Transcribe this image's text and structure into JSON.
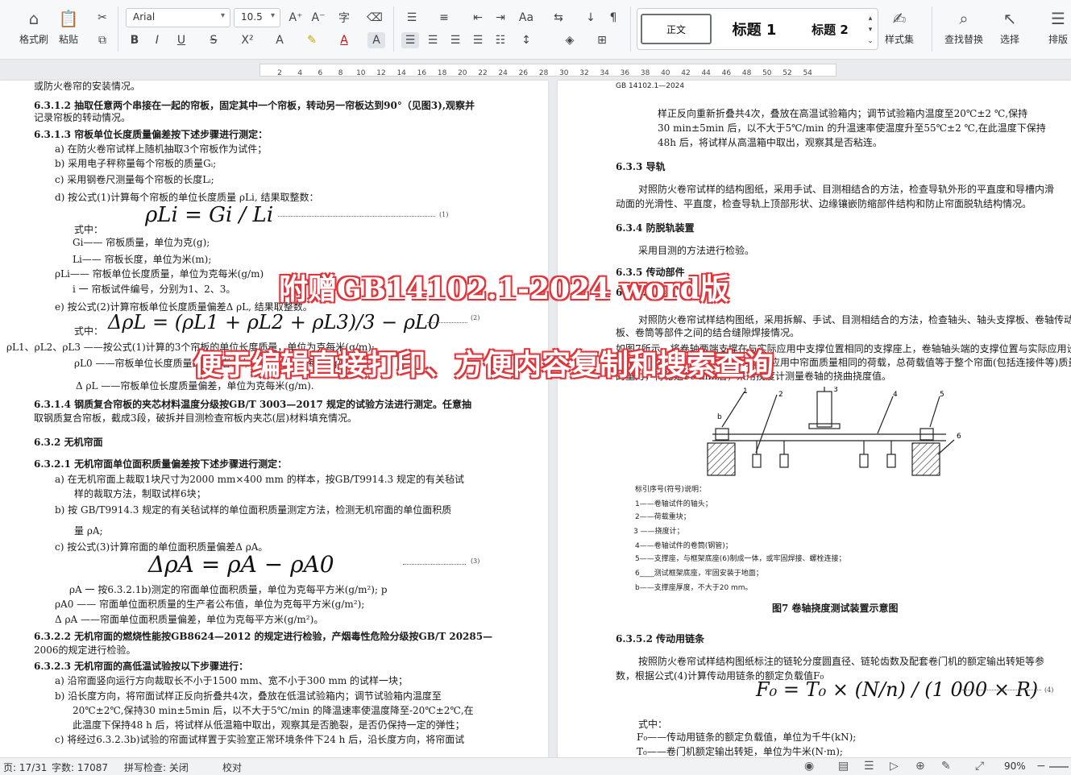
{
  "ribbon": {
    "format_painter": "格式刷",
    "paste": "粘贴",
    "font_name": "Arial",
    "font_size": "10.5",
    "styles": {
      "normal": "正文",
      "h1": "标题 1",
      "h2": "标题 2"
    },
    "style_set": "样式集",
    "find_replace": "查找替换",
    "select": "选择",
    "sort": "排版"
  },
  "ruler": {
    "ticks": [
      "2",
      "4",
      "6",
      "8",
      "10",
      "12",
      "14",
      "16",
      "18",
      "20",
      "22",
      "24",
      "26",
      "28",
      "30",
      "32",
      "34",
      "36",
      "38",
      "40",
      "42",
      "44",
      "46",
      "48",
      "50",
      "52",
      "54"
    ]
  },
  "left_page": {
    "lines": [
      "或防火卷帘的安装情况。",
      "6.3.1.2  抽取任意两个串接在一起的帘板，固定其中一个帘板，转动另一帘板达到90°（见图3),观察并",
      "记录帘板的转动情况。",
      "6.3.1.3  帘板单位长度质量偏差按下述步骤进行测定：",
      "a)   在防火卷帘试样上随机抽取3个帘板作为试件；",
      "b)   采用电子秤称量每个帘板的质量Gᵢ;",
      "c)   采用钢卷尺测量每个帘板的长度Lᵢ;",
      "d)   按公式(1)计算每个帘板的单位长度质量 ρLi, 结果取整数：",
      "式中：",
      "Gi——  帘板质量，单位为克(g);",
      "Li——  帘板长度，单位为米(m);",
      "ρLi——  帘板单位长度质量，单位为克每米(g/m)",
      "i   一 帘板试件编号，分别为1、2、3。",
      "e)   按公式(2)计算帘板单位长度质量偏差Δ ρL, 结果取整数。",
      "式中：",
      "ρL1、ρL2、ρL3 ——按公式(1)计算的3个帘板的单位长度质量，单位为克每米(g/m);",
      "ρL0 ——帘板单位长度质量的生产者公布值，单位为克每米(g/m);",
      "Δ ρL  ——帘板单位长度质量偏差，单位为克每米(g/m).",
      "6.3.1.4  钢质复合帘板的夹芯材料温度分级按GB/T   3003—2017 规定的试验方法进行测定。任意抽",
      "取钢质复合帘板，截成3段，破拆并目测检查帘板内夹芯(层)材料填充情况。",
      "6.3.2  无机帘面",
      "6.3.2.1  无机帘面单位面积质量偏差按下述步骤进行测定：",
      "a)   在无机帘面上裁取1块尺寸为2000 mm×400 mm   的样本，按GB/T9914.3   规定的有关毡试",
      "样的裁取方法，制取试样6块；",
      "b)   按 GB/T9914.3   规定的有关毡试样的单位面积质量测定方法，检测无机帘面的单位面积质",
      "量 ρA;",
      "c)   按公式(3)计算帘面的单位面积质量偏差Δ ρA。",
      "ρA  一  按6.3.2.1b)测定的帘面单位面积质量，单位为克每平方米(g/m²); p",
      "ρA0 ——  帘面单位面积质量的生产者公布值，单位为克每平方米(g/m²);",
      "Δ ρA ——帘面单位面积质量偏差，单位为克每平方米(g/m²)。",
      "6.3.2.2  无机帘面的燃烧性能按GB8624—2012   的规定进行检验，产烟毒性危险分级按GB/T   20285—",
      "2006的规定进行检验。",
      "6.3.2.3  无机帘面的高低温试验按以下步骤进行：",
      "a)   沿帘面竖向运行方向裁取长不小于1500 mm、宽不小于300 mm 的试样一块；",
      "b)   沿长度方向，将帘面试样正反向折叠共4次，叠放在低温试验箱内；调节试验箱内温度至",
      "20℃±2℃,保持30  min±5min  后，以不大于5℃/min 的降温速率使温度降至-20℃±2℃,在",
      "此温度下保持48 h 后，将试样从低温箱中取出，观察其是否脆裂，是否仍保持一定的弹性；",
      "c)   将经过6.3.2.3b)试验的帘面试样置于实验室正常环境条件下24 h 后，沿长度方向，将帘面试"
    ],
    "formulas": {
      "f1": "ρLi = Gi / Li",
      "f2": "ΔρL = (ρL1 + ρL2 + ρL3)/3 − ρL0",
      "f3": "ΔρA = ρA − ρA0",
      "n1": "(1)",
      "n2": "(2)",
      "n3": "(3)"
    }
  },
  "right_page": {
    "header": "GB      14102.1—2024",
    "lines": [
      "样正反向重新折叠共4次，叠放在高温试验箱内；调节试验箱内温度至20℃±2  ℃,保持",
      "30     min±5min 后，以不大于5℃/min 的升温速率使温度升至55℃±2  ℃,在此温度下保持",
      "48h 后，将试样从高温箱中取出，观察其是否粘连。",
      "6.3.3   导轨",
      "对照防火卷帘试样的结构图纸，采用手试、目测相结合的方法，检查导轨外形的平直度和导槽内滑",
      "动面的光滑性、平直度，检查导轨上顶部形状、边缘镶嵌防缩部件结构和防止帘面脱轨结构情况。",
      "6.3.4   防脱轨装置",
      "采用目测的方法进行检验。",
      "6.3.5   传动部件",
      "6.3.5.1   卷轴",
      "对照防火卷帘试样结构图纸，采用拆解、手试、目测相结合的方法，检查轴头、轴头支撑板、卷轴传动",
      "板、卷筒等部件之间的结合缝隙焊接情况。",
      "如图7所示，将卷轴两端支撑在与实际应用中支撑位置相同的支撑座上，卷轴轴头端的支撑位置与实际应用设计",
      "的相同，在卷轴中部均匀施加与实际应用中帘面质量相同的荷载，总荷载值等于整个帘面(包括连接件等)质量",
      "的重力，待稳定10 min后，采用挠度计测量卷轴的挠曲挠度值。",
      "标引序号(符号)说明：",
      "1——卷轴试件的轴头；",
      "2——荷载重块；",
      "3  ——挠度计；",
      "4——卷轴试件的卷筒(钢管)；",
      "5——支撑座，与框架底座(6)制成一体，或牢固焊接、螺栓连接；",
      "6____测试框架底座，牢固安装于地面；",
      "b——支撑座厚度，不大于20  mm。",
      "图7   卷轴挠度测试装置示意图",
      "6.3.5.2   传动用链条",
      "按照防火卷帘试样结构图纸标注的链轮分度圆直径、链轮齿数及配套卷门机的额定输出转矩等参",
      "数，根据公式(4)计算传动用链条的额定负载值F₀",
      "式中：",
      "F₀——传动用链条的额定负载值，单位为千牛(kN);",
      "T₀——卷门机额定输出转矩，单位为牛米(N·m);"
    ],
    "formula4": "F₀ = T₀ × (N/n) / (1 000 × R)",
    "n4": "(4)",
    "figure_labels": [
      "1",
      "2",
      "3",
      "4",
      "5",
      "6",
      "b"
    ]
  },
  "overlay": {
    "line1": "附赠GB14102.1-2024 word版",
    "line2": "便于编辑直接打印、方便内容复制和搜索查询"
  },
  "status": {
    "page": "页: 17/31",
    "words": "字数: 17087",
    "spell": "拼写检查: 关闭",
    "proof": "校对",
    "zoom": "90%"
  }
}
